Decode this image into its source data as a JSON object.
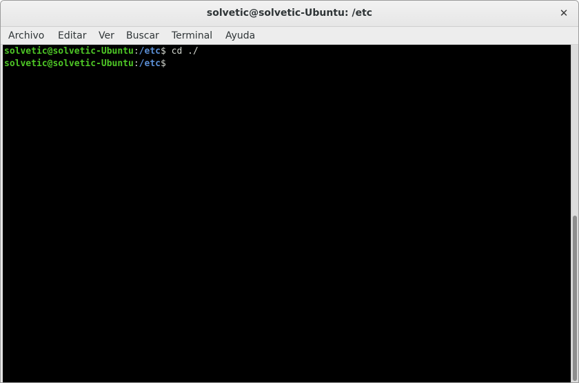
{
  "window": {
    "title": "solvetic@solvetic-Ubuntu: /etc",
    "close_symbol": "✕"
  },
  "menu": {
    "items": [
      {
        "label": "Archivo"
      },
      {
        "label": "Editar"
      },
      {
        "label": "Ver"
      },
      {
        "label": "Buscar"
      },
      {
        "label": "Terminal"
      },
      {
        "label": "Ayuda"
      }
    ]
  },
  "terminal": {
    "lines": [
      {
        "user": "solvetic@solvetic-Ubuntu",
        "sep": ":",
        "path": "/etc",
        "prompt": "$",
        "command": " cd ./"
      },
      {
        "user": "solvetic@solvetic-Ubuntu",
        "sep": ":",
        "path": "/etc",
        "prompt": "$",
        "command": ""
      }
    ],
    "colors": {
      "background": "#000000",
      "user": "#4ec726",
      "path": "#5b8fd6",
      "text": "#d3d7cf"
    }
  },
  "icons": {
    "close": "close-icon"
  }
}
